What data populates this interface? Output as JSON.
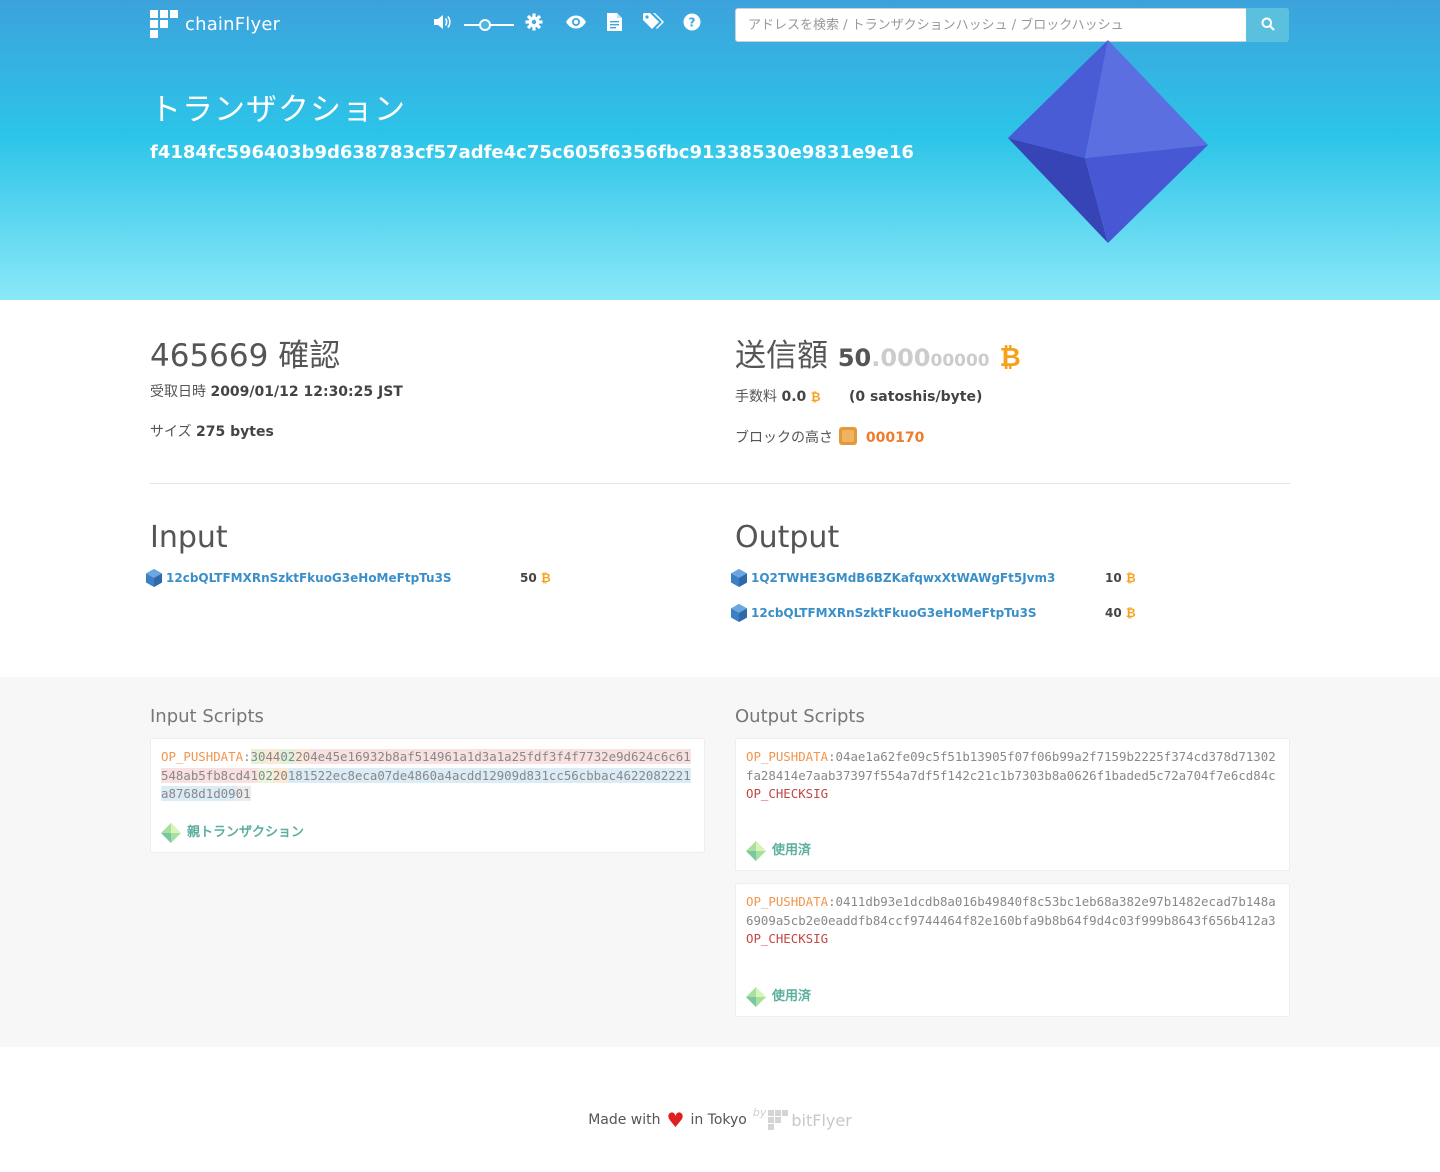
{
  "header": {
    "app_name": "chainFlyer",
    "search_placeholder": "アドレスを検索 / トランザクションハッシュ / ブロックハッシュ"
  },
  "hero": {
    "title": "トランザクション",
    "tx_hash": "f4184fc596403b9d638783cf57adfe4c75c605f6356fbc91338530e9831e9e16"
  },
  "summary": {
    "confirmations": "465669",
    "confirmations_label": "確認",
    "received_label": "受取日時",
    "received_value": "2009/01/12 12:30:25 JST",
    "size_label": "サイズ",
    "size_value": "275 bytes",
    "amount_label": "送信額",
    "amount_int": "50",
    "amount_dec1": ".000",
    "amount_dec2": "00000",
    "fee_label": "手数料",
    "fee_value": "0.0",
    "fee_rate": "(0 satoshis/byte)",
    "block_height_label": "ブロックの高さ",
    "block_height_value": "000170"
  },
  "input": {
    "title": "Input",
    "rows": [
      {
        "address": "12cbQLTFMXRnSzktFkuoG3eHoMeFtpTu3S",
        "value": "50"
      }
    ]
  },
  "output": {
    "title": "Output",
    "rows": [
      {
        "address": "1Q2TWHE3GMdB6BZKafqwxXtWAWgFt5Jvm3",
        "value": "10"
      },
      {
        "address": "12cbQLTFMXRnSzktFkuoG3eHoMeFtpTu3S",
        "value": "40"
      }
    ]
  },
  "input_scripts": {
    "title": "Input Scripts",
    "op": "OP_PUSHDATA",
    "parts": [
      "30",
      "44",
      "02",
      "20",
      "4e45e16932b8af514961a1d3a1a25fdf3f4f7732e9d624c6c61548ab5fb8cd41",
      "02",
      "20",
      "181522ec8eca07de4860a4acdd12909d831cc56cbbac4622082221a8768d1d09",
      "01"
    ],
    "link": "親トランザクション"
  },
  "output_scripts": {
    "title": "Output Scripts",
    "cards": [
      {
        "op": "OP_PUSHDATA",
        "data": "04ae1a62fe09c5f51b13905f07f06b99a2f7159b2225f374cd378d71302fa28414e7aab37397f554a7df5f142c21c1b7303b8a0626f1baded5c72a704f7e6cd84c",
        "op2": "OP_CHECKSIG",
        "link": "使用済"
      },
      {
        "op": "OP_PUSHDATA",
        "data": "0411db93e1dcdb8a016b49840f8c53bc1eb68a382e97b1482ecad7b148a6909a5cb2e0eaddfb84ccf9744464f82e160bfa9b8b64f9d4c03f999b8643f656b412a3",
        "op2": "OP_CHECKSIG",
        "link": "使用済"
      }
    ]
  },
  "footer": {
    "made_with": "Made with",
    "in_tokyo": "in Tokyo",
    "by": "by",
    "brand": "bitFlyer"
  },
  "colors": {
    "hero_top": "#3da2dc",
    "hero_bottom": "#8be8f8",
    "link": "#3a8fc8",
    "bitcoin": "#f7a11a",
    "op_code": "#f0954d",
    "checksig": "#c24646"
  },
  "icons": [
    "volume-icon",
    "gear-icon",
    "eye-icon",
    "document-icon",
    "tags-icon",
    "help-icon",
    "search-icon",
    "bitcoin-icon",
    "block-icon",
    "address-hex-icon",
    "gem-icon",
    "heart-icon"
  ]
}
